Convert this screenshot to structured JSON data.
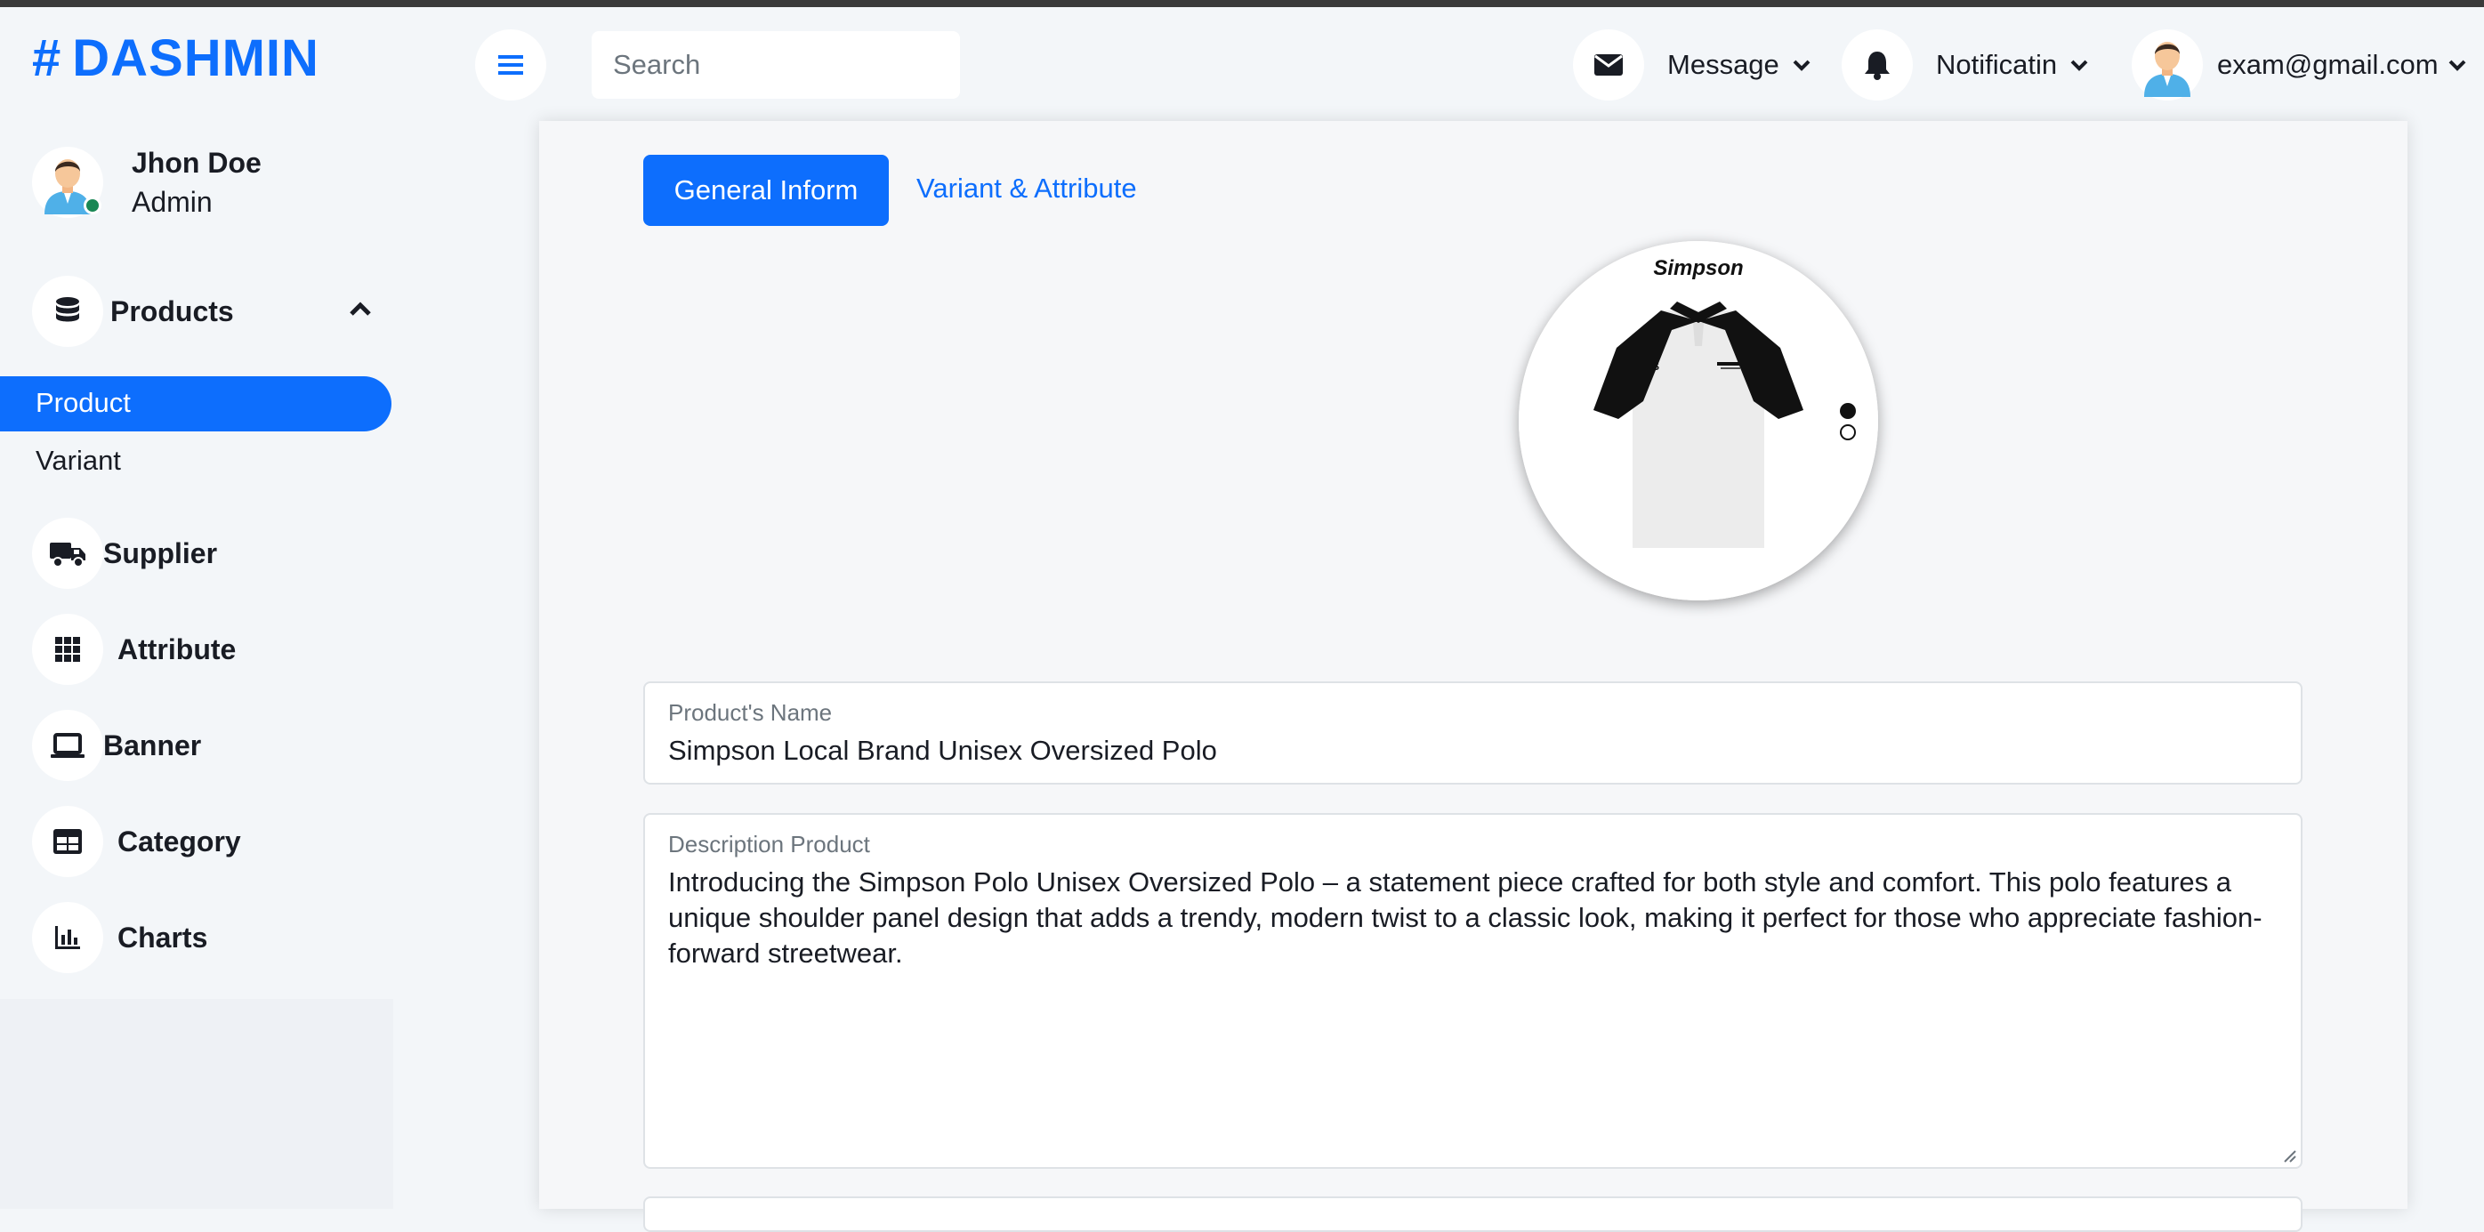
{
  "brand": {
    "hash": "#",
    "name": "DASHMIN"
  },
  "user": {
    "name": "Jhon Doe",
    "role": "Admin"
  },
  "sidebar": {
    "items": [
      {
        "label": "Products",
        "icon": "database-icon"
      },
      {
        "label": "Supplier",
        "icon": "truck-icon"
      },
      {
        "label": "Attribute",
        "icon": "grid-icon"
      },
      {
        "label": "Banner",
        "icon": "laptop-icon"
      },
      {
        "label": "Category",
        "icon": "table-icon"
      },
      {
        "label": "Charts",
        "icon": "chart-bar-icon"
      }
    ],
    "sub_items": [
      {
        "label": "Product",
        "active": true
      },
      {
        "label": "Variant",
        "active": false
      }
    ]
  },
  "topbar": {
    "search_placeholder": "Search",
    "message_label": "Message",
    "notification_label": "Notificatin",
    "account_label": "exam@gmail.com"
  },
  "tabs": [
    {
      "label": "General Inform",
      "active": true
    },
    {
      "label": "Variant & Attribute",
      "active": false
    }
  ],
  "product_image": {
    "brand_text": "Simpson",
    "slide_count": 2,
    "active_slide": 1
  },
  "form": {
    "name_label": "Product's Name",
    "name_value": "Simpson Local Brand Unisex Oversized Polo",
    "description_label": "Description Product",
    "description_value": "Introducing the Simpson Polo Unisex Oversized Polo – a statement piece crafted for both style and comfort. This polo features a unique shoulder panel design that adds a trendy, modern twist to a classic look, making it perfect for those who appreciate fashion-forward streetwear."
  },
  "colors": {
    "accent": "#0d6efd",
    "online": "#198754",
    "text": "#191c24"
  }
}
